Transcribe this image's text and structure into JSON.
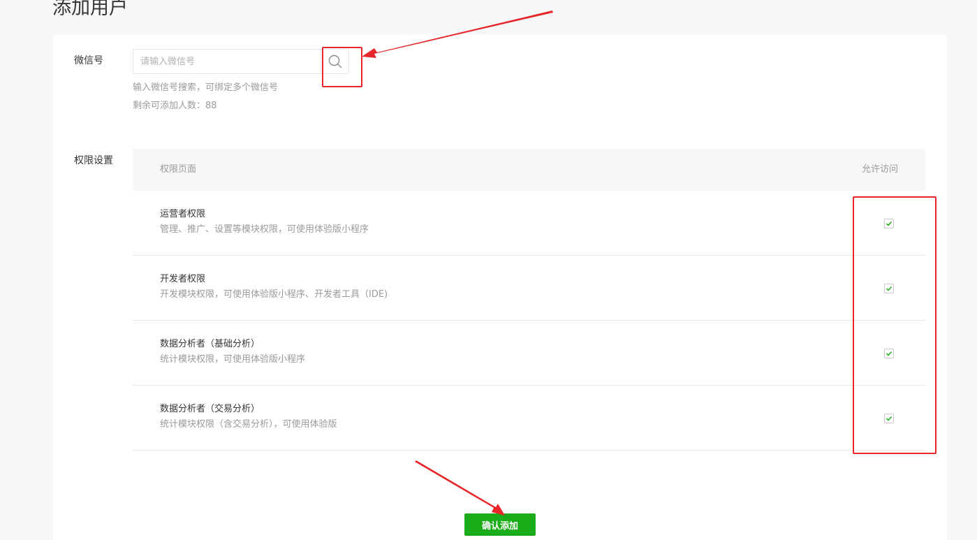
{
  "page": {
    "title": "添加用户"
  },
  "wechat": {
    "label": "微信号",
    "placeholder": "请输入微信号",
    "value": "",
    "search_icon": "search-icon",
    "hint_search": "输入微信号搜索，可绑定多个微信号",
    "hint_remaining": "剩余可添加人数：88"
  },
  "permissions": {
    "label": "权限设置",
    "col_page": "权限页面",
    "col_allow": "允许访问",
    "rows": [
      {
        "title": "运营者权限",
        "desc": "管理、推广、设置等模块权限，可使用体验版小程序",
        "checked": true
      },
      {
        "title": "开发者权限",
        "desc": "开发模块权限，可使用体验版小程序、开发者工具（IDE)",
        "checked": true
      },
      {
        "title": "数据分析者（基础分析）",
        "desc": "统计模块权限，可使用体验版小程序",
        "checked": true
      },
      {
        "title": "数据分析者（交易分析）",
        "desc": "统计模块权限（含交易分析），可使用体验版",
        "checked": true
      }
    ]
  },
  "actions": {
    "confirm_label": "确认添加"
  },
  "colors": {
    "primary": "#1aad19",
    "annotation": "#e8262a",
    "check": "#1aad19"
  }
}
